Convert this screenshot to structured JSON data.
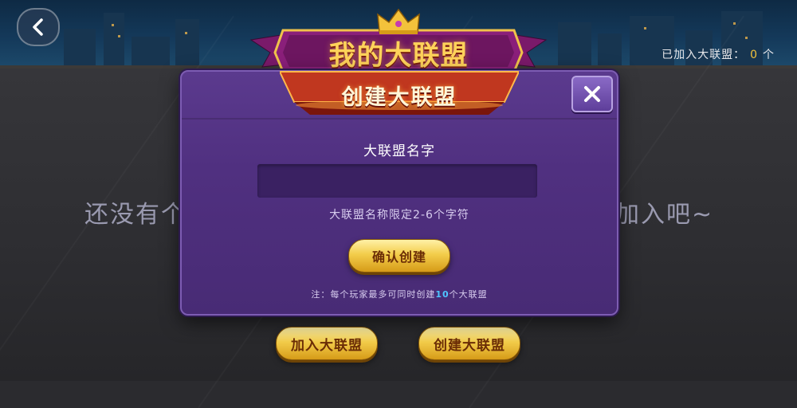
{
  "header": {
    "title": "我的大联盟",
    "joined_label": "已加入大联盟：",
    "joined_count": "0",
    "joined_unit": "个"
  },
  "background": {
    "hint_left": "还没有个",
    "hint_right": "加入吧~"
  },
  "actions": {
    "join_label": "加入大联盟",
    "create_label": "创建大联盟"
  },
  "dialog": {
    "title": "创建大联盟",
    "field_label": "大联盟名字",
    "input_value": "",
    "input_placeholder": "",
    "limit_hint": "大联盟名称限定2-6个字符",
    "confirm_label": "确认创建",
    "note_prefix": "注：每个玩家最多可同时创建",
    "note_count": "10",
    "note_suffix": "个大联盟"
  },
  "colors": {
    "accent_gold": "#f3cd4b",
    "dialog_purple": "#503080",
    "highlight_blue": "#4fc6ff"
  },
  "icons": {
    "back": "chevron-left-icon",
    "close": "close-icon",
    "crown": "crown-icon"
  }
}
